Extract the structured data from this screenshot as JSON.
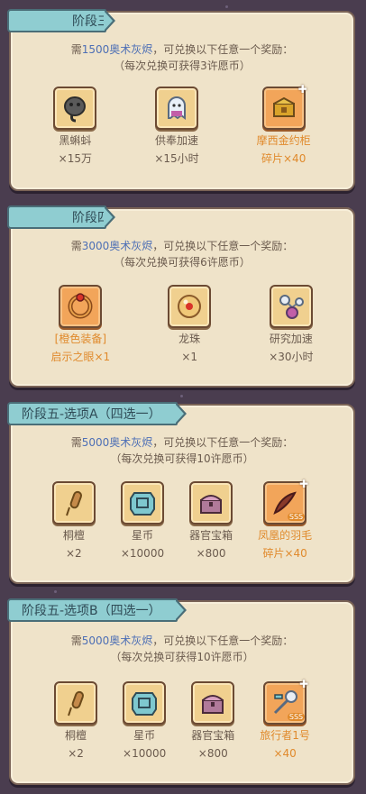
{
  "colors": {
    "accent_blue": "#4d6fb5",
    "accent_orange": "#e08a2c",
    "tag": "#8fcdd1"
  },
  "sections": [
    {
      "tag": "阶段三",
      "desc_pre": "需",
      "amount": "1500奥术灰烬",
      "desc_post": "，可兑换以下任意一个奖励：",
      "note": "（每次兑换可获得3许愿币）",
      "items": [
        {
          "name": "黑蝌蚪",
          "qty": "×15万",
          "icon": "tadpole-icon",
          "style": "normal"
        },
        {
          "name": "供奉加速",
          "qty": "×15小时",
          "icon": "ghost-icon",
          "style": "normal"
        },
        {
          "name": "摩西金约柜",
          "qty": "碎片×40",
          "icon": "ark-icon",
          "style": "orange",
          "fragment": true
        }
      ]
    },
    {
      "tag": "阶段四",
      "desc_pre": "需",
      "amount": "3000奥术灰烬",
      "desc_post": "，可兑换以下任意一个奖励：",
      "note": "（每次兑换可获得6许愿币）",
      "items": [
        {
          "name": "[橙色装备]",
          "qty": "启示之眼×1",
          "icon": "ring-icon",
          "style": "orange"
        },
        {
          "name": "龙珠",
          "qty": "×1",
          "icon": "dragon-ball-icon",
          "style": "normal"
        },
        {
          "name": "研究加速",
          "qty": "×30小时",
          "icon": "flask-icon",
          "style": "normal"
        }
      ]
    },
    {
      "tag": "阶段五-选项A（四选一）",
      "desc_pre": "需",
      "amount": "5000奥术灰烬",
      "desc_post": "，可兑换以下任意一个奖励：",
      "note": "（每次兑换可获得10许愿币）",
      "items": [
        {
          "name": "桐檀",
          "qty": "×2",
          "icon": "stick-icon",
          "style": "normal"
        },
        {
          "name": "星币",
          "qty": "×10000",
          "icon": "star-coin-icon",
          "style": "normal"
        },
        {
          "name": "器官宝箱",
          "qty": "×800",
          "icon": "chest-icon",
          "style": "normal"
        },
        {
          "name": "凤凰的羽毛",
          "qty": "碎片×40",
          "icon": "feather-icon",
          "style": "orange",
          "fragment": true
        }
      ]
    },
    {
      "tag": "阶段五-选项B（四选一）",
      "desc_pre": "需",
      "amount": "5000奥术灰烬",
      "desc_post": "，可兑换以下任意一个奖励：",
      "note": "（每次兑换可获得10许愿币）",
      "items": [
        {
          "name": "桐檀",
          "qty": "×2",
          "icon": "stick-icon",
          "style": "normal"
        },
        {
          "name": "星币",
          "qty": "×10000",
          "icon": "star-coin-icon",
          "style": "normal"
        },
        {
          "name": "器官宝箱",
          "qty": "×800",
          "icon": "chest-icon",
          "style": "normal"
        },
        {
          "name": "旅行者1号",
          "qty": "×40",
          "icon": "probe-icon",
          "style": "orange",
          "fragment": true
        }
      ]
    }
  ]
}
